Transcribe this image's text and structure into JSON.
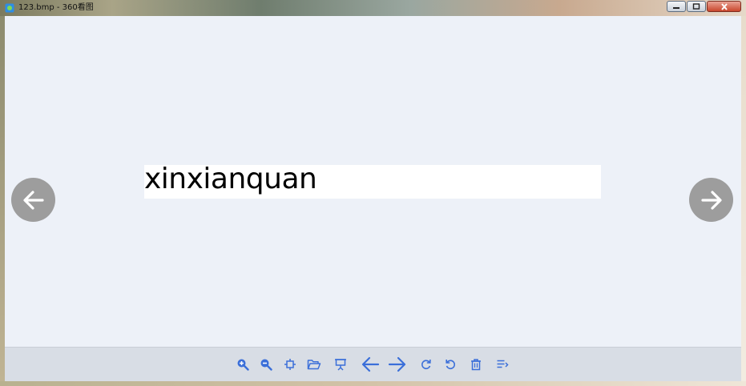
{
  "window": {
    "title": "123.bmp - 360看图"
  },
  "image": {
    "text": "xinxianquan"
  },
  "navigation": {
    "prev_icon": "arrow-left-icon",
    "next_icon": "arrow-right-icon"
  },
  "toolbar": {
    "tools": [
      {
        "name": "zoom-in",
        "icon": "zoom-in-icon"
      },
      {
        "name": "zoom-out",
        "icon": "zoom-out-icon"
      },
      {
        "name": "fit-to-window",
        "icon": "fit-icon"
      },
      {
        "name": "open-folder",
        "icon": "folder-icon"
      },
      {
        "name": "slideshow",
        "icon": "slideshow-icon"
      },
      {
        "name": "previous",
        "icon": "arrow-left-icon"
      },
      {
        "name": "next",
        "icon": "arrow-right-icon"
      },
      {
        "name": "rotate-clockwise",
        "icon": "rotate-right-icon"
      },
      {
        "name": "rotate-counterclockwise",
        "icon": "rotate-left-icon"
      },
      {
        "name": "delete",
        "icon": "trash-icon"
      },
      {
        "name": "menu",
        "icon": "menu-icon"
      }
    ]
  },
  "colors": {
    "accent": "#3b6fd9",
    "viewer_background": "#edf1f8",
    "toolbar_background": "#d8dde5",
    "nav_button": "#9d9d9d"
  }
}
